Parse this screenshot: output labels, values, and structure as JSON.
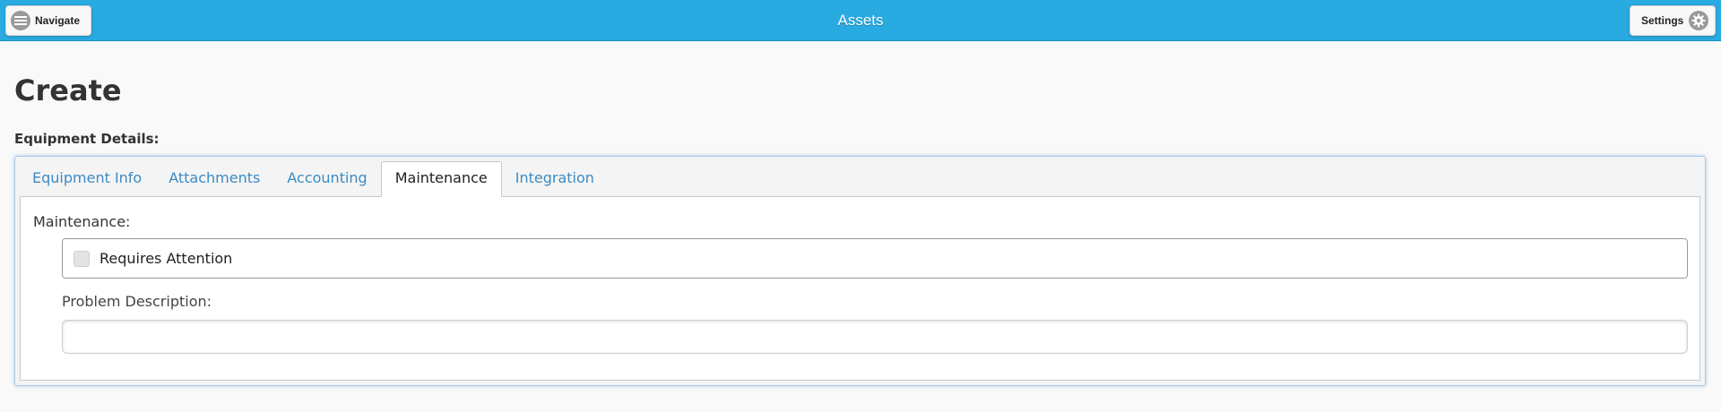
{
  "header": {
    "title": "Assets",
    "navigate_label": "Navigate",
    "navigate_icon": "hamburger-menu-icon",
    "settings_label": "Settings",
    "settings_icon": "gear-icon",
    "bar_color": "#29abe2"
  },
  "page": {
    "title": "Create",
    "section_label": "Equipment Details:"
  },
  "tabs": [
    {
      "label": "Equipment Info",
      "active": false
    },
    {
      "label": "Attachments",
      "active": false
    },
    {
      "label": "Accounting",
      "active": false
    },
    {
      "label": "Maintenance",
      "active": true
    },
    {
      "label": "Integration",
      "active": false
    }
  ],
  "maintenance": {
    "label": "Maintenance:",
    "requires_attention_label": "Requires Attention",
    "requires_attention_checked": false,
    "problem_description_label": "Problem Description:",
    "problem_description_value": "",
    "problem_description_placeholder": ""
  }
}
